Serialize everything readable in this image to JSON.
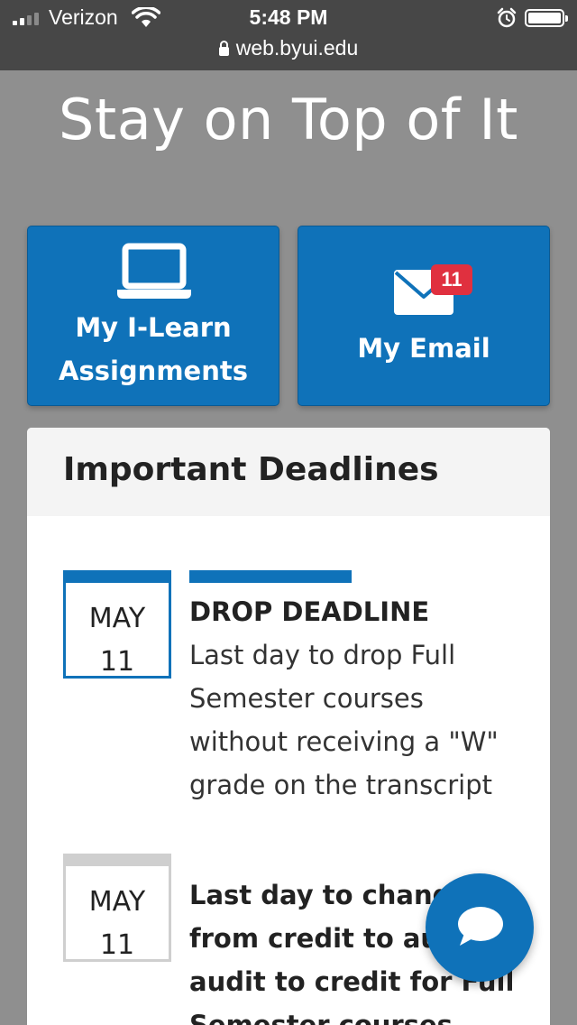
{
  "status_bar": {
    "carrier": "Verizon",
    "time": "5:48 PM",
    "url": "web.byui.edu"
  },
  "page": {
    "title": "Stay on Top of It"
  },
  "tiles": {
    "ilearn": {
      "line1": "My I-Learn",
      "line2": "Assignments",
      "icon": "laptop-icon"
    },
    "email": {
      "label": "My Email",
      "badge": "11",
      "icon": "mail-icon"
    }
  },
  "deadlines": {
    "title": "Important Deadlines",
    "items": [
      {
        "month": "MAY",
        "day": "11",
        "title": "DROP DEADLINE",
        "lines": [
          "Last day to drop Full",
          "Semester courses",
          "without receiving a \"W\"",
          "grade on the transcript"
        ]
      },
      {
        "month": "MAY",
        "day": "11",
        "lines": [
          "Last day to change",
          "from credit to audit or",
          "audit to credit for Full",
          "Semester courses"
        ]
      }
    ]
  },
  "colors": {
    "brand_blue": "#0f72b9",
    "badge_red": "#e0303f",
    "background": "#8f8f8f"
  }
}
